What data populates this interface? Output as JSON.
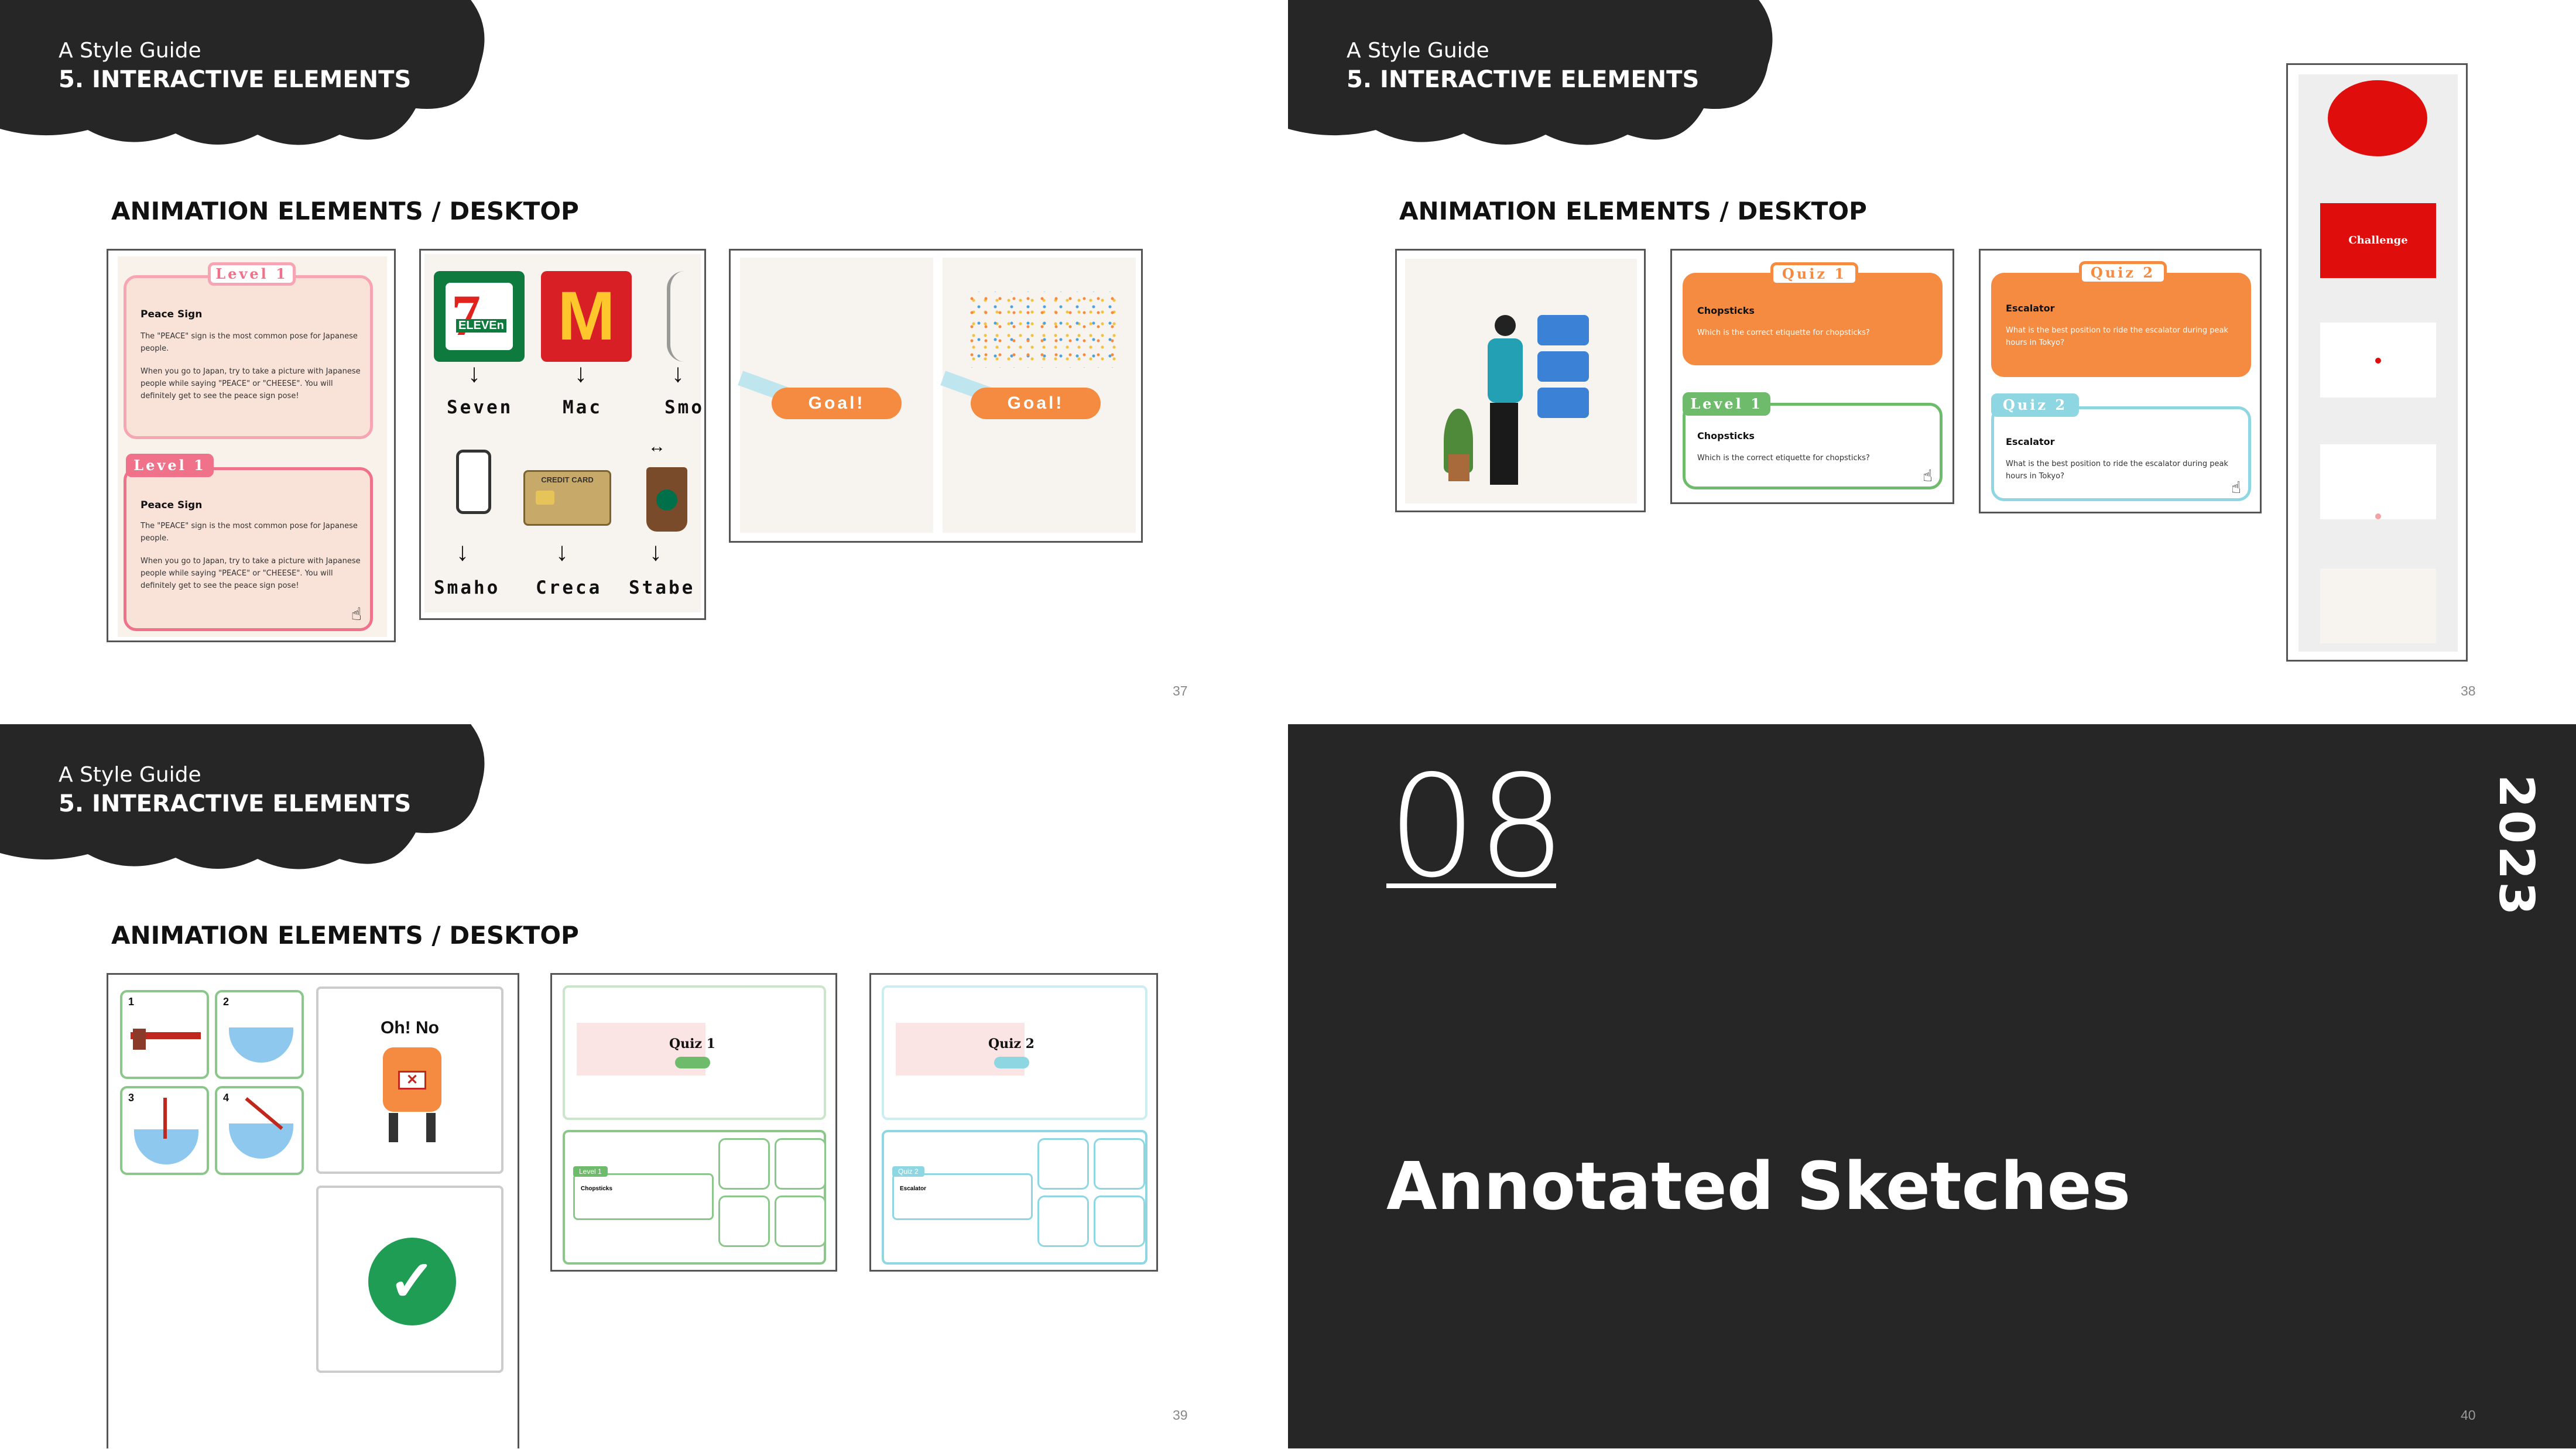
{
  "header": {
    "guide": "A Style Guide",
    "section": "5. INTERACTIVE ELEMENTS"
  },
  "subsection": "ANIMATION ELEMENTS / DESKTOP",
  "pages": {
    "p37": "37",
    "p38": "38",
    "p39": "39",
    "p40": "40"
  },
  "slide37": {
    "level_tag": "Level 1",
    "peace_title": "Peace Sign",
    "peace_text1": "The \"PEACE\" sign is the most common pose for Japanese people.",
    "peace_text2": "When you go to Japan, try to take a picture with Japanese people while saying \"PEACE\" or \"CHEESE\". You will definitely get to see the peace sign pose!",
    "brand_labels": [
      "Seven",
      "Mac",
      "Smo",
      "Smaho",
      "Creca",
      "Stabe"
    ],
    "brand_icons": [
      "seven-eleven-logo",
      "mcdonalds-logo",
      "hand-icon",
      "smartphone-hand-icon",
      "credit-card-icon",
      "starbucks-drink-icon"
    ],
    "seven_logo_text": "ELEVEn",
    "credit_card_text": "CREDIT CARD",
    "arrow": "↓",
    "goal": "Goal!"
  },
  "slide38": {
    "quiz1_tag": "Quiz 1",
    "quiz2_tag": "Quiz 2",
    "level_tag": "Level 1",
    "chop_title": "Chopsticks",
    "chop_q": "Which is the correct etiquette for chopsticks?",
    "esc_title": "Escalator",
    "esc_q": "What is the best position to ride the escalator during peak hours in Tokyo?",
    "challenge": "Challenge"
  },
  "slide39": {
    "nums": [
      "1",
      "2",
      "3",
      "4"
    ],
    "ohno": "Oh! No",
    "quiz1": "Quiz 1",
    "quiz2": "Quiz 2",
    "mini_level": "Level 1",
    "mini_quiz": "Quiz 2",
    "mini_chop": "Chopsticks",
    "mini_esc": "Escalator"
  },
  "slide40": {
    "number": "08",
    "title": "Annotated Sketches",
    "year": "2023"
  },
  "colors": {
    "dark": "#262626",
    "orange": "#f58a41",
    "pink": "#f0728a",
    "green": "#6dbb6b",
    "blue": "#8fd6e3",
    "red": "#e00d0d"
  }
}
